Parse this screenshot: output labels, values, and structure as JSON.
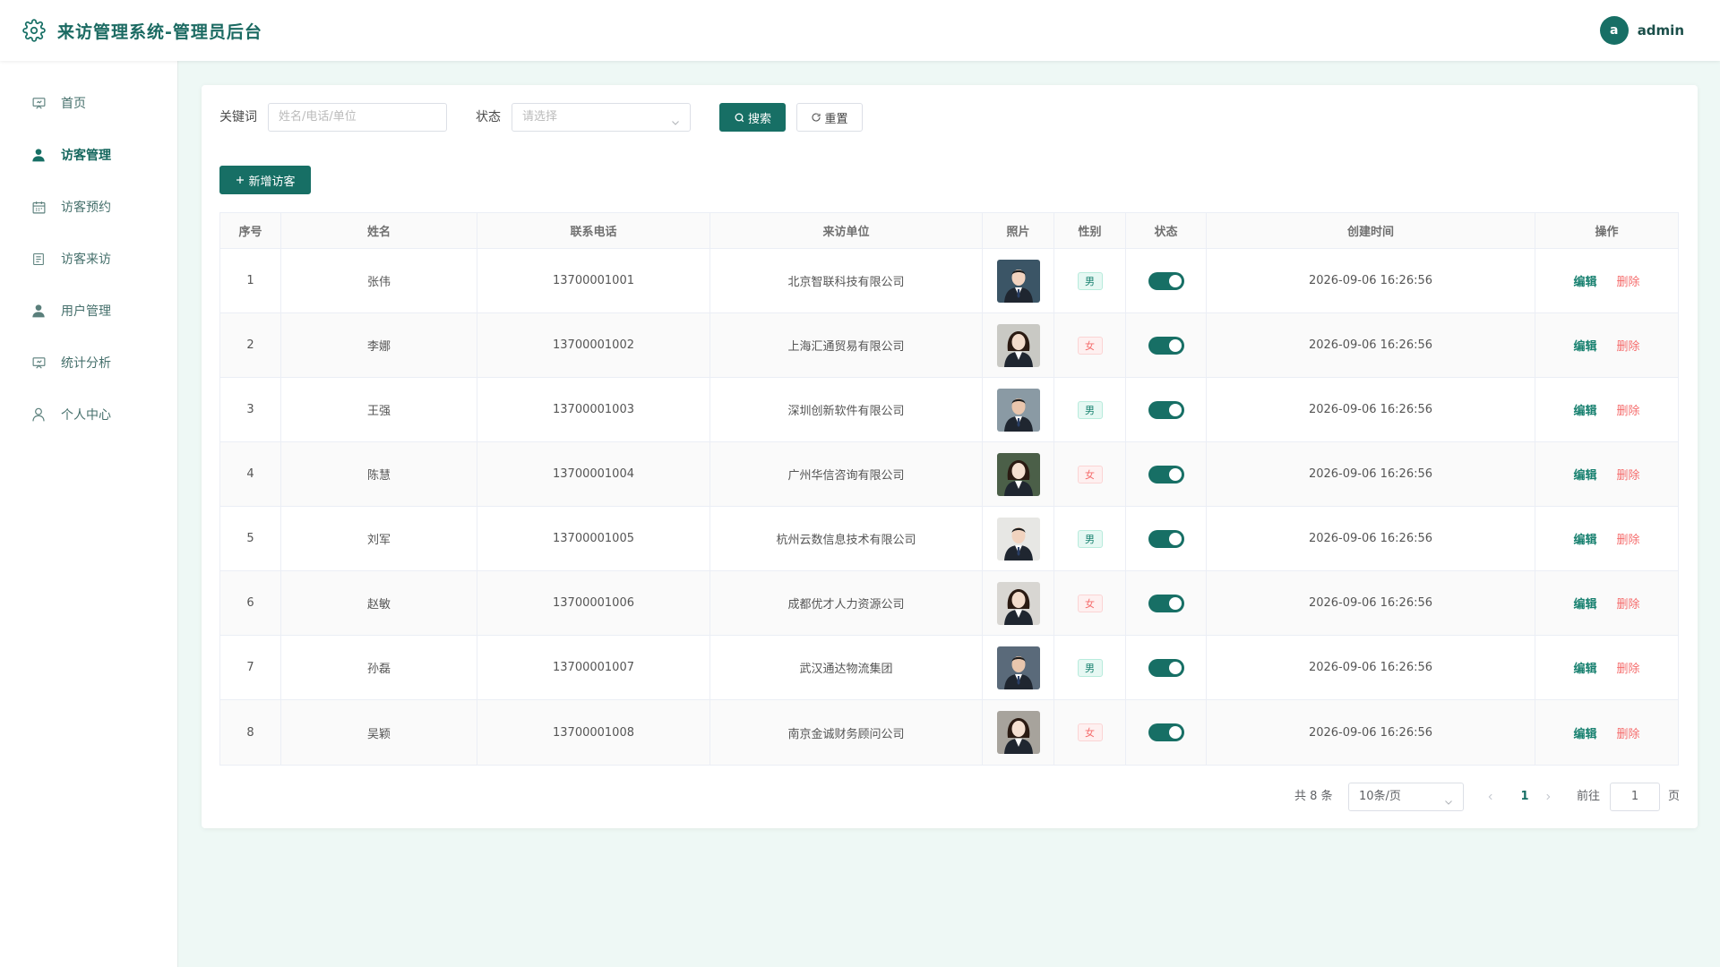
{
  "header": {
    "title": "来访管理系统-管理员后台",
    "avatar_letter": "a",
    "username": "admin"
  },
  "sidebar": {
    "items": [
      {
        "label": "首页",
        "icon": "presentation-icon",
        "active": false
      },
      {
        "label": "访客管理",
        "icon": "user-icon",
        "active": true
      },
      {
        "label": "访客预约",
        "icon": "calendar-icon",
        "active": false
      },
      {
        "label": "访客来访",
        "icon": "document-icon",
        "active": false
      },
      {
        "label": "用户管理",
        "icon": "user-icon",
        "active": false
      },
      {
        "label": "统计分析",
        "icon": "presentation-icon",
        "active": false
      },
      {
        "label": "个人中心",
        "icon": "user-outline-icon",
        "active": false
      }
    ]
  },
  "filters": {
    "keyword_label": "关键词",
    "keyword_placeholder": "姓名/电话/单位",
    "status_label": "状态",
    "status_placeholder": "请选择",
    "search_label": "搜索",
    "reset_label": "重置"
  },
  "add_button": "新增访客",
  "table": {
    "headers": [
      "序号",
      "姓名",
      "联系电话",
      "来访单位",
      "照片",
      "性别",
      "状态",
      "创建时间",
      "操作"
    ],
    "rows": [
      {
        "index": "1",
        "name": "张伟",
        "phone": "13700001001",
        "company": "北京智联科技有限公司",
        "gender": "男",
        "enabled": true,
        "created": "2026-09-06 16:26:56"
      },
      {
        "index": "2",
        "name": "李娜",
        "phone": "13700001002",
        "company": "上海汇通贸易有限公司",
        "gender": "女",
        "enabled": true,
        "created": "2026-09-06 16:26:56"
      },
      {
        "index": "3",
        "name": "王强",
        "phone": "13700001003",
        "company": "深圳创新软件有限公司",
        "gender": "男",
        "enabled": true,
        "created": "2026-09-06 16:26:56"
      },
      {
        "index": "4",
        "name": "陈慧",
        "phone": "13700001004",
        "company": "广州华信咨询有限公司",
        "gender": "女",
        "enabled": true,
        "created": "2026-09-06 16:26:56"
      },
      {
        "index": "5",
        "name": "刘军",
        "phone": "13700001005",
        "company": "杭州云数信息技术有限公司",
        "gender": "男",
        "enabled": true,
        "created": "2026-09-06 16:26:56"
      },
      {
        "index": "6",
        "name": "赵敏",
        "phone": "13700001006",
        "company": "成都优才人力资源公司",
        "gender": "女",
        "enabled": true,
        "created": "2026-09-06 16:26:56"
      },
      {
        "index": "7",
        "name": "孙磊",
        "phone": "13700001007",
        "company": "武汉通达物流集团",
        "gender": "男",
        "enabled": true,
        "created": "2026-09-06 16:26:56"
      },
      {
        "index": "8",
        "name": "吴颖",
        "phone": "13700001008",
        "company": "南京金诚财务顾问公司",
        "gender": "女",
        "enabled": true,
        "created": "2026-09-06 16:26:56"
      }
    ],
    "edit_label": "编辑",
    "delete_label": "删除"
  },
  "pagination": {
    "total_text": "共 8 条",
    "page_size": "10条/页",
    "current_page": "1",
    "goto_label": "前往",
    "goto_value": "1",
    "page_unit": "页"
  },
  "colors": {
    "primary": "#176f65",
    "danger": "#f56c6c",
    "background": "#eef8f5"
  }
}
